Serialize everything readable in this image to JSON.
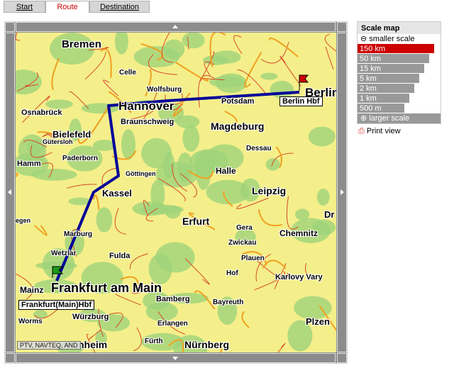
{
  "tabs": [
    {
      "label": "Start"
    },
    {
      "label": "Route",
      "active": true
    },
    {
      "label": "Destination"
    }
  ],
  "map": {
    "cities": [
      "Bremen",
      "Hannover",
      "Berlin",
      "Celle",
      "Wolfsburg",
      "Potsdam",
      "Osnabrück",
      "Bielefeld",
      "Gütersloh",
      "Braunschweig",
      "Magdeburg",
      "Dessau",
      "Paderborn",
      "Hamm",
      "Göttingen",
      "Halle",
      "Kassel",
      "Leipzig",
      "Dr",
      "Erfurt",
      "Gera",
      "Chemnitz",
      "egen",
      "Marburg",
      "Zwickau",
      "Plauen",
      "Wetzlar",
      "Fulda",
      "Hof",
      "Karlovy Vary",
      "Mainz",
      "Frankfurt am Main",
      "Bamberg",
      "Bayreuth",
      "Würzburg",
      "Worms",
      "Erlangen",
      "Fürth",
      "Nürnberg",
      "Plzen",
      "nheim"
    ],
    "start_station": "Frankfurt(Main)Hbf",
    "end_station": "Berlin Hbf",
    "copyright": "PTV, NAVTEQ, AND",
    "route_color": "#000099"
  },
  "scale": {
    "title": "Scale map",
    "smaller": "smaller scale",
    "larger": "larger scale",
    "levels": [
      "150 km",
      "50 km",
      "15 km",
      "5 km",
      "2 km",
      "1 km",
      "500 m"
    ],
    "selected": "150 km",
    "selected_color": "#cc0000"
  },
  "print_label": "Print view"
}
